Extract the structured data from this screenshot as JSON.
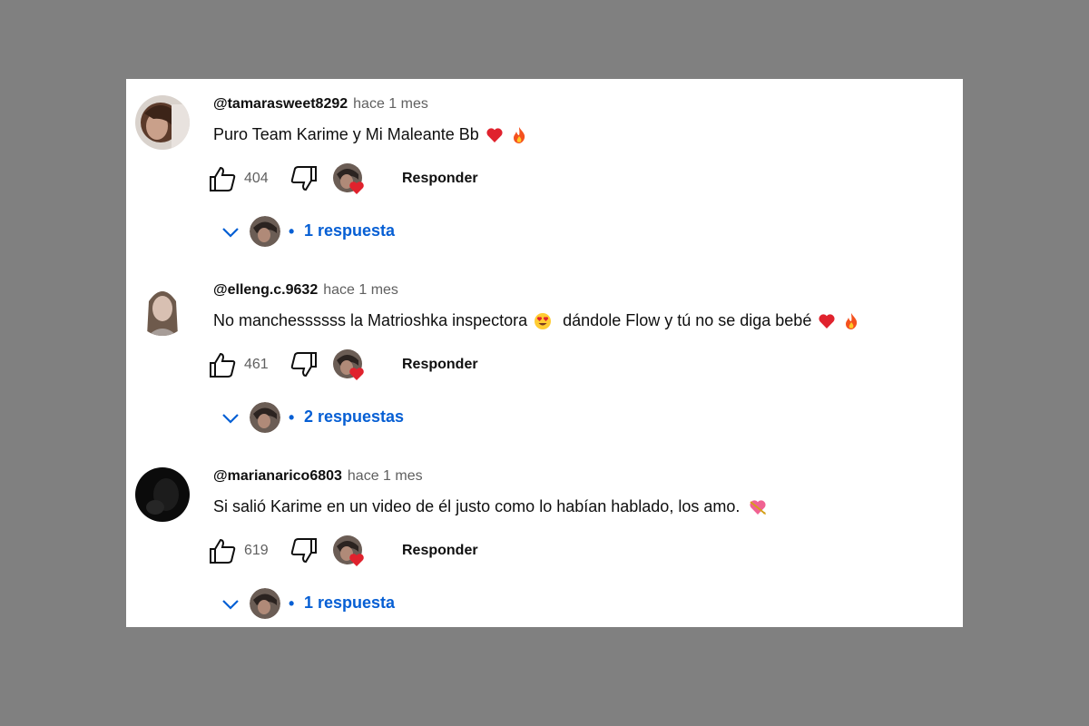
{
  "comments": [
    {
      "handle": "@tamarasweet8292",
      "time": "hace 1 mes",
      "text": "Puro Team Karime y Mi Maleante Bb",
      "emojis": [
        "heart",
        "fire"
      ],
      "likes": "404",
      "reply_label": "Responder",
      "replies_label": "1 respuesta",
      "avatar": "avatar-brown-hair"
    },
    {
      "handle": "@elleng.c.9632",
      "time": "hace 1 mes",
      "text": "No manchessssss la Matrioshka inspectora",
      "text_after": "dándole Flow y tú no se diga bebé",
      "emojis": [
        "heart-eyes",
        "heart",
        "fire"
      ],
      "likes": "461",
      "reply_label": "Responder",
      "replies_label": "2 respuestas",
      "avatar": "avatar-light-portrait"
    },
    {
      "handle": "@marianarico6803",
      "time": "hace 1 mes",
      "text": "Si salió Karime en un video de él justo como lo habían hablado, los amo.",
      "emojis": [
        "heart-with-arrow"
      ],
      "likes": "619",
      "reply_label": "Responder",
      "replies_label": "1 respuesta",
      "avatar": "avatar-dark"
    }
  ],
  "colors": {
    "background": "#808080",
    "panel": "#ffffff",
    "link_blue": "#065fd4",
    "text": "#0f0f0f",
    "muted": "#606060"
  }
}
